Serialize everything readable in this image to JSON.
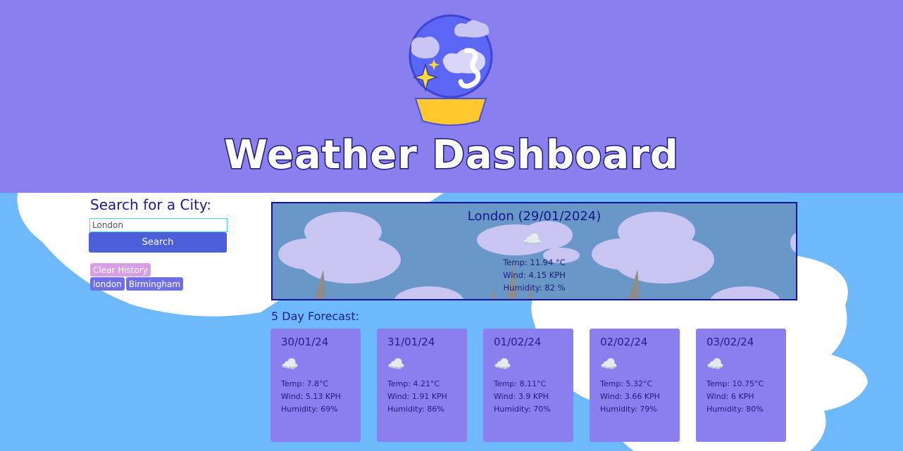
{
  "header": {
    "title": "Weather Dashboard",
    "logo_icon": "crystal-ball-weather-icon"
  },
  "search": {
    "heading": "Search for a City:",
    "input_value": "London",
    "button_label": "Search",
    "clear_label": "Clear History",
    "history": [
      "london",
      "Birmingham"
    ]
  },
  "current": {
    "city_date": "London (29/01/2024)",
    "icon": "cloud-icon",
    "temp": "Temp: 11.94 °C",
    "wind": "Wind: 4.15 KPH",
    "humidity": "Humidity: 82 %"
  },
  "forecast": {
    "heading": "5 Day Forecast:",
    "days": [
      {
        "date": "30/01/24",
        "icon": "cloud-icon",
        "temp": "Temp: 7.8°C",
        "wind": "Wind: 5.13 KPH",
        "humidity": "Humidity: 69%"
      },
      {
        "date": "31/01/24",
        "icon": "cloud-icon",
        "temp": "Temp: 4.21°C",
        "wind": "Wind: 1.91 KPH",
        "humidity": "Humidity: 86%"
      },
      {
        "date": "01/02/24",
        "icon": "cloud-icon",
        "temp": "Temp: 8.11°C",
        "wind": "Wind: 3.9 KPH",
        "humidity": "Humidity: 70%"
      },
      {
        "date": "02/02/24",
        "icon": "cloud-icon",
        "temp": "Temp: 5.32°C",
        "wind": "Wind: 3.66 KPH",
        "humidity": "Humidity: 79%"
      },
      {
        "date": "03/02/24",
        "icon": "cloud-icon",
        "temp": "Temp: 10.75°C",
        "wind": "Wind: 6 KPH",
        "humidity": "Humidity: 80%"
      }
    ]
  },
  "colors": {
    "header_bg": "#8a7fef",
    "page_bg": "#6db9fb",
    "card_bg": "#8b7fef",
    "current_bg": "#6897c8",
    "search_btn": "#4c5fd8"
  }
}
